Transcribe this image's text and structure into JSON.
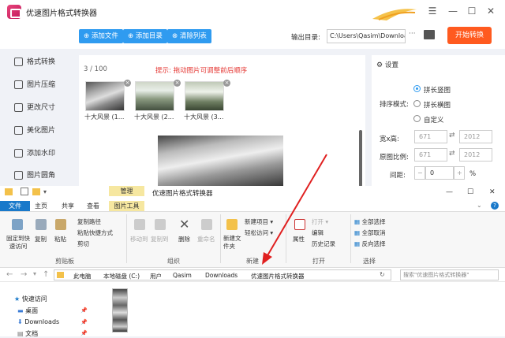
{
  "app": {
    "title": "优速图片格式转换器",
    "minimize": "—",
    "maximize": "☐",
    "close": "✕",
    "menu": "☰"
  },
  "toolbar": {
    "add_file": "添加文件",
    "add_dir": "添加目录",
    "clear_list": "清除列表",
    "output_label": "输出目录:",
    "output_path": "C:\\Users\\Qasim\\Downloads",
    "more": "···",
    "start": "开始转换"
  },
  "sidebar": {
    "items": [
      {
        "label": "格式转换"
      },
      {
        "label": "图片压缩"
      },
      {
        "label": "更改尺寸"
      },
      {
        "label": "美化图片"
      },
      {
        "label": "添加水印"
      },
      {
        "label": "图片圆角"
      }
    ]
  },
  "main": {
    "count": "3 / 100",
    "hint": "提示: 拖动图片可调整前后顺序",
    "thumbs": [
      {
        "caption": "十大风景 (1..."
      },
      {
        "caption": "十大风景 (2..."
      },
      {
        "caption": "十大风景 (3..."
      }
    ],
    "close": "×"
  },
  "settings": {
    "title": "设置",
    "layout_options": [
      {
        "label": "拼长竖图",
        "selected": true
      },
      {
        "label": "拼长横图",
        "selected": false
      },
      {
        "label": "自定义",
        "selected": false
      }
    ],
    "layout_label": "排序模式:",
    "size_label": "宽x高:",
    "width": "671",
    "height": "2012",
    "ratio_label": "原图比例:",
    "ratio_w": "671",
    "ratio_h": "2012",
    "gap_label": "间距:",
    "gap": "0",
    "gap_minus": "−",
    "gap_plus": "+",
    "gap_unit": "%"
  },
  "explorer": {
    "title": "优速图片格式转换器",
    "manage": "管理",
    "picture_tools": "图片工具",
    "tabs": [
      "文件",
      "主页",
      "共享",
      "查看"
    ],
    "minimize": "—",
    "maximize": "☐",
    "close": "✕",
    "clipboard": {
      "pin": "固定到快速访问",
      "copy": "复制",
      "paste": "粘贴",
      "copy_path": "复制路径",
      "paste_shortcut": "粘贴快捷方式",
      "cut": "剪切",
      "group": "剪贴板"
    },
    "organize": {
      "move_to": "移动到",
      "copy_to": "复制到",
      "delete": "删除",
      "rename": "重命名",
      "group": "组织"
    },
    "new": {
      "new_folder": "新建文件夹",
      "new_item": "新建项目 ▾",
      "easy_access": "轻松访问 ▾",
      "group": "新建"
    },
    "open": {
      "properties": "属性",
      "open": "打开 ▾",
      "edit": "编辑",
      "history": "历史记录",
      "group": "打开"
    },
    "select": {
      "select_all": "全部选择",
      "select_none": "全部取消",
      "invert": "反向选择",
      "group": "选择"
    },
    "breadcrumbs": [
      "此电脑",
      "本地磁盘 (C:)",
      "用户",
      "Qasim",
      "Downloads",
      "优速图片格式转换器"
    ],
    "search_placeholder": "搜索\"优速图片格式转换器\"",
    "nav": [
      {
        "label": "快速访问"
      },
      {
        "label": "桌面"
      },
      {
        "label": "Downloads"
      },
      {
        "label": "文档"
      }
    ]
  }
}
